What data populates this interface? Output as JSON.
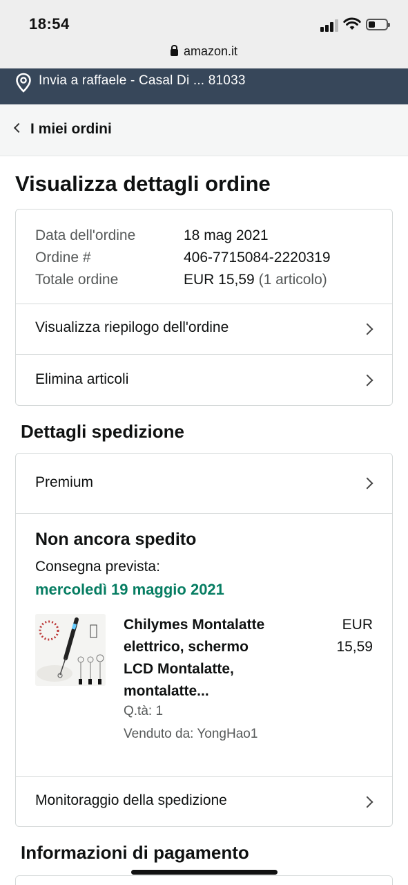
{
  "status_bar": {
    "time": "18:54"
  },
  "browser": {
    "url": "amazon.it"
  },
  "delivery": {
    "text": "Invia a raffaele - Casal Di ... 81033"
  },
  "nav": {
    "back_label": "I miei ordini"
  },
  "page": {
    "title": "Visualizza dettagli ordine"
  },
  "order": {
    "date_label": "Data dell'ordine",
    "date_value": "18 mag 2021",
    "number_label": "Ordine #",
    "number_value": "406-7715084-2220319",
    "total_label": "Totale ordine",
    "total_value": "EUR 15,59",
    "total_items": "(1 articolo)"
  },
  "order_links": {
    "summary": "Visualizza riepilogo dell'ordine",
    "delete": "Elimina articoli"
  },
  "shipping": {
    "heading": "Dettagli spedizione",
    "tier": "Premium",
    "status": "Non ancora spedito",
    "eta_label": "Consegna prevista:",
    "eta_date": "mercoledì 19 maggio 2021",
    "eta_color": "#067d62",
    "track_label": "Monitoraggio della spedizione"
  },
  "item": {
    "title_lines": [
      "Chilymes Montalatte",
      "elettrico, schermo",
      "LCD Montalatte,",
      "montalatte..."
    ],
    "price_lines": [
      "EUR",
      "15,59"
    ],
    "qty": "Q.tà: 1",
    "seller": "Venduto da: YongHao1"
  },
  "payment": {
    "heading": "Informazioni di pagamento"
  },
  "colors": {
    "header_bg": "#37475a",
    "border": "#d5d9d9"
  }
}
